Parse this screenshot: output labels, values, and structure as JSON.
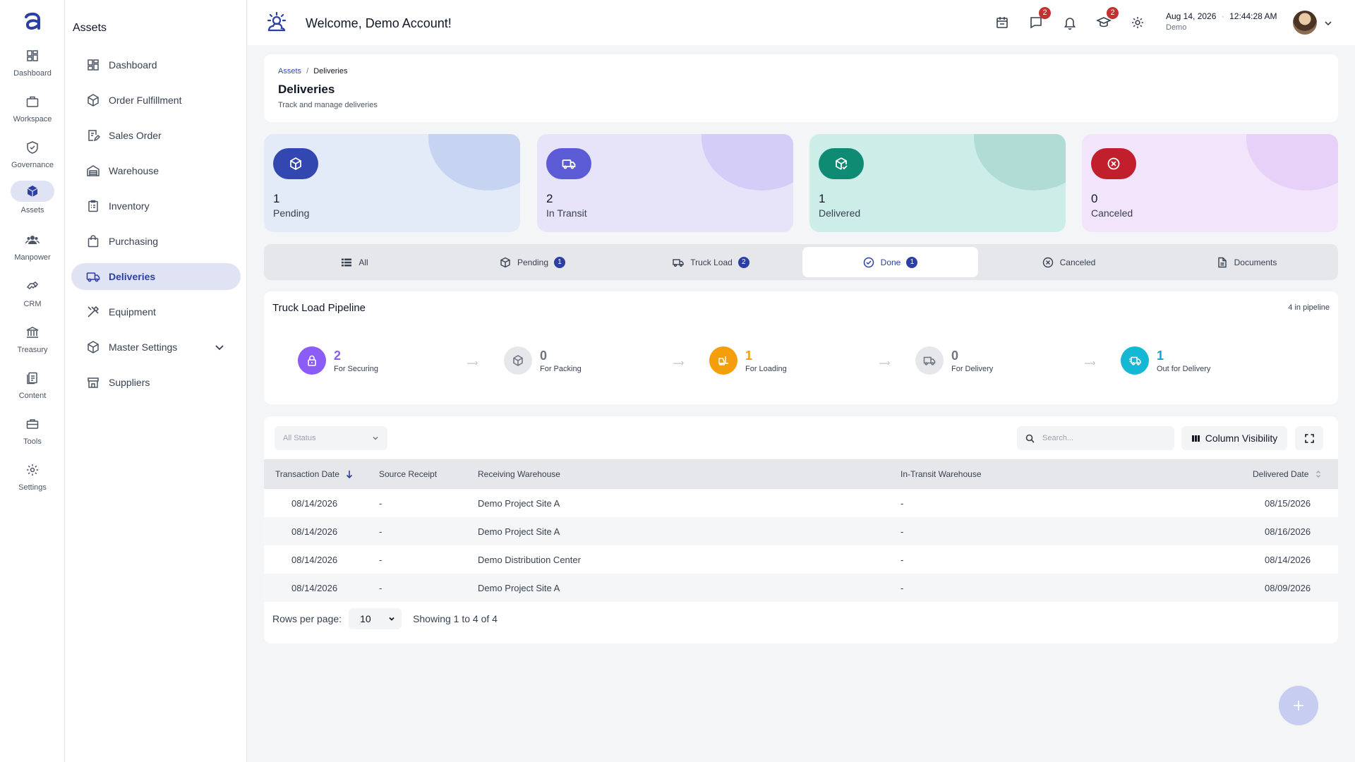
{
  "rail": {
    "items": [
      {
        "label": "Dashboard",
        "icon": "dashboard-icon"
      },
      {
        "label": "Workspace",
        "icon": "briefcase-icon"
      },
      {
        "label": "Governance",
        "icon": "shield-icon"
      },
      {
        "label": "Assets",
        "icon": "cube-icon",
        "active": true
      },
      {
        "label": "Manpower",
        "icon": "people-icon"
      },
      {
        "label": "CRM",
        "icon": "handshake-icon"
      },
      {
        "label": "Treasury",
        "icon": "bank-icon"
      },
      {
        "label": "Content",
        "icon": "document-icon"
      },
      {
        "label": "Tools",
        "icon": "toolbox-icon"
      },
      {
        "label": "Settings",
        "icon": "gear-icon"
      }
    ]
  },
  "sidebar": {
    "title": "Assets",
    "items": [
      {
        "label": "Dashboard"
      },
      {
        "label": "Order Fulfillment"
      },
      {
        "label": "Sales Order"
      },
      {
        "label": "Warehouse"
      },
      {
        "label": "Inventory"
      },
      {
        "label": "Purchasing"
      },
      {
        "label": "Deliveries",
        "active": true
      },
      {
        "label": "Equipment"
      },
      {
        "label": "Master Settings"
      },
      {
        "label": "Suppliers"
      }
    ]
  },
  "header": {
    "welcome": "Welcome, Demo Account!",
    "messages_badge": "2",
    "learning_badge": "2",
    "date": "Aug 14, 2026",
    "time": "12:44:28 AM",
    "user": "Demo"
  },
  "page": {
    "breadcrumb_parent": "Assets",
    "breadcrumb_sep": "/",
    "breadcrumb_current": "Deliveries",
    "title": "Deliveries",
    "subtitle": "Track and manage deliveries"
  },
  "stats": [
    {
      "value": "1",
      "label": "Pending",
      "color": "#3347b0",
      "bg": "#e3eaf8",
      "blob": "#c7d4f1"
    },
    {
      "value": "2",
      "label": "In Transit",
      "color": "#5b5bd6",
      "bg": "#e7e4fa",
      "blob": "#d3cdf7"
    },
    {
      "value": "1",
      "label": "Delivered",
      "color": "#0f8a73",
      "bg": "#cdeee8",
      "blob": "#b1dcd6"
    },
    {
      "value": "0",
      "label": "Canceled",
      "color": "#c01f2b",
      "bg": "#f2e4fb",
      "blob": "#e7d1f8"
    }
  ],
  "tabs": [
    {
      "label": "All"
    },
    {
      "label": "Pending",
      "badge": "1"
    },
    {
      "label": "Truck Load",
      "badge": "2"
    },
    {
      "label": "Done",
      "badge": "1",
      "active": true
    },
    {
      "label": "Canceled"
    },
    {
      "label": "Documents"
    }
  ],
  "pipeline": {
    "title": "Truck Load Pipeline",
    "count": "4 in pipeline",
    "arrow": "—›",
    "stages": [
      {
        "value": "2",
        "label": "For Securing",
        "color": "#8b5cf6",
        "bg": "#8b5cf6"
      },
      {
        "value": "0",
        "label": "For Packing",
        "color": "#6b7280",
        "bg": "#e5e7eb"
      },
      {
        "value": "1",
        "label": "For Loading",
        "color": "#f59e0b",
        "bg": "#f59e0b"
      },
      {
        "value": "0",
        "label": "For Delivery",
        "color": "#6b7280",
        "bg": "#e5e7eb"
      },
      {
        "value": "1",
        "label": "Out for Delivery",
        "color": "#0ea5c9",
        "bg": "#14b8d4"
      }
    ]
  },
  "table": {
    "status_filter": "All Status",
    "search_placeholder": "Search...",
    "column_visibility": "Column Visibility",
    "columns": [
      "Transaction Date",
      "Source Receipt",
      "Receiving Warehouse",
      "In-Transit Warehouse",
      "Delivered Date"
    ],
    "rows": [
      [
        "08/14/2026",
        "-",
        "Demo Project Site A",
        "-",
        "08/15/2026"
      ],
      [
        "08/14/2026",
        "-",
        "Demo Project Site A",
        "-",
        "08/16/2026"
      ],
      [
        "08/14/2026",
        "-",
        "Demo Distribution Center",
        "-",
        "08/14/2026"
      ],
      [
        "08/14/2026",
        "-",
        "Demo Project Site A",
        "-",
        "08/09/2026"
      ]
    ],
    "rows_per_page_label": "Rows per page:",
    "rows_per_page": "10",
    "showing": "Showing 1 to 4 of 4"
  }
}
